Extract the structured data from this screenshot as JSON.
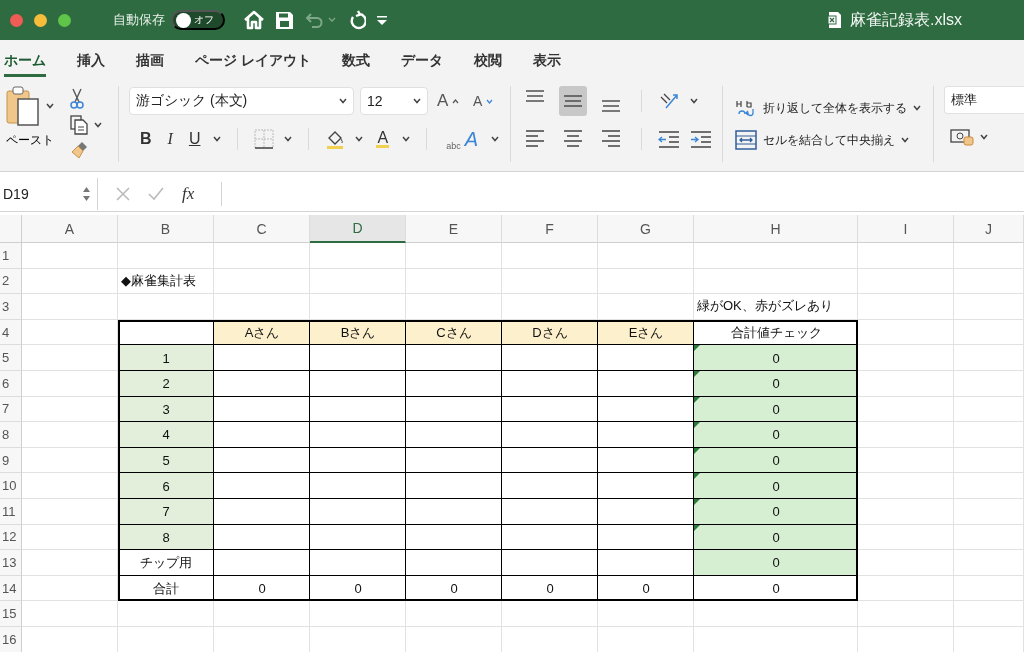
{
  "window": {
    "title": "麻雀記録表.xlsx",
    "autosave": {
      "label": "自動保存",
      "toggle_text": "オフ",
      "on": false
    }
  },
  "tabs": [
    {
      "label": "ホーム",
      "selected": true
    },
    {
      "label": "挿入",
      "selected": false
    },
    {
      "label": "描画",
      "selected": false
    },
    {
      "label": "ページ レイアウト",
      "selected": false
    },
    {
      "label": "数式",
      "selected": false
    },
    {
      "label": "データ",
      "selected": false
    },
    {
      "label": "校閲",
      "selected": false
    },
    {
      "label": "表示",
      "selected": false
    }
  ],
  "ribbon": {
    "paste_label": "ペースト",
    "font_name": "游ゴシック (本文)",
    "font_size": "12",
    "grow_font": "A",
    "shrink_font": "A",
    "bold": "B",
    "italic": "I",
    "underline": "U",
    "font_color": "A",
    "text_effects": {
      "small": "abc",
      "large": "A"
    },
    "vertical_align": [
      {
        "kind": "top",
        "selected": false
      },
      {
        "kind": "middle",
        "selected": true
      },
      {
        "kind": "bottom",
        "selected": false
      }
    ],
    "wrap_text": "折り返して全体を表示する",
    "merge_center": "セルを結合して中央揃え",
    "number_format": "標準"
  },
  "formula_bar": {
    "name_box": "D19",
    "fx": "fx"
  },
  "sheet": {
    "columns": [
      {
        "label": "A",
        "selected": false
      },
      {
        "label": "B",
        "selected": false
      },
      {
        "label": "C",
        "selected": false
      },
      {
        "label": "D",
        "selected": true
      },
      {
        "label": "E",
        "selected": false
      },
      {
        "label": "F",
        "selected": false
      },
      {
        "label": "G",
        "selected": false
      },
      {
        "label": "H",
        "selected": false
      },
      {
        "label": "I",
        "selected": false
      },
      {
        "label": "J",
        "selected": false
      }
    ],
    "rows": [
      {
        "number": "1",
        "cells": [
          {},
          {},
          {},
          {},
          {},
          {},
          {},
          {},
          {},
          {}
        ]
      },
      {
        "number": "2",
        "cells": [
          {},
          {
            "text": "◆麻雀集計表"
          },
          {},
          {},
          {},
          {},
          {},
          {},
          {},
          {}
        ]
      },
      {
        "number": "3",
        "cells": [
          {},
          {},
          {},
          {},
          {},
          {},
          {},
          {
            "text": "緑がOK、赤がズレあり"
          },
          {},
          {}
        ]
      },
      {
        "number": "4",
        "cells": [
          {},
          {
            "kind": "box"
          },
          {
            "kind": "header",
            "text": "Aさん"
          },
          {
            "kind": "header",
            "text": "Bさん"
          },
          {
            "kind": "header",
            "text": "Cさん"
          },
          {
            "kind": "header",
            "text": "Dさん"
          },
          {
            "kind": "header",
            "text": "Eさん"
          },
          {
            "kind": "box",
            "text": "合計値チェック"
          },
          {},
          {}
        ]
      },
      {
        "number": "5",
        "cells": [
          {},
          {
            "kind": "label",
            "text": "1"
          },
          {
            "kind": "box"
          },
          {
            "kind": "box"
          },
          {
            "kind": "box"
          },
          {
            "kind": "box"
          },
          {
            "kind": "box"
          },
          {
            "kind": "check",
            "text": "0",
            "flag": true
          },
          {},
          {}
        ]
      },
      {
        "number": "6",
        "cells": [
          {},
          {
            "kind": "label",
            "text": "2"
          },
          {
            "kind": "box"
          },
          {
            "kind": "box"
          },
          {
            "kind": "box"
          },
          {
            "kind": "box"
          },
          {
            "kind": "box"
          },
          {
            "kind": "check",
            "text": "0",
            "flag": true
          },
          {},
          {}
        ]
      },
      {
        "number": "7",
        "cells": [
          {},
          {
            "kind": "label",
            "text": "3"
          },
          {
            "kind": "box"
          },
          {
            "kind": "box"
          },
          {
            "kind": "box"
          },
          {
            "kind": "box"
          },
          {
            "kind": "box"
          },
          {
            "kind": "check",
            "text": "0",
            "flag": true
          },
          {},
          {}
        ]
      },
      {
        "number": "8",
        "cells": [
          {},
          {
            "kind": "label",
            "text": "4"
          },
          {
            "kind": "box"
          },
          {
            "kind": "box"
          },
          {
            "kind": "box"
          },
          {
            "kind": "box"
          },
          {
            "kind": "box"
          },
          {
            "kind": "check",
            "text": "0",
            "flag": true
          },
          {},
          {}
        ]
      },
      {
        "number": "9",
        "cells": [
          {},
          {
            "kind": "label",
            "text": "5"
          },
          {
            "kind": "box"
          },
          {
            "kind": "box"
          },
          {
            "kind": "box"
          },
          {
            "kind": "box"
          },
          {
            "kind": "box"
          },
          {
            "kind": "check",
            "text": "0",
            "flag": true
          },
          {},
          {}
        ]
      },
      {
        "number": "10",
        "cells": [
          {},
          {
            "kind": "label",
            "text": "6"
          },
          {
            "kind": "box"
          },
          {
            "kind": "box"
          },
          {
            "kind": "box"
          },
          {
            "kind": "box"
          },
          {
            "kind": "box"
          },
          {
            "kind": "check",
            "text": "0",
            "flag": true
          },
          {},
          {}
        ]
      },
      {
        "number": "11",
        "cells": [
          {},
          {
            "kind": "label",
            "text": "7"
          },
          {
            "kind": "box"
          },
          {
            "kind": "box"
          },
          {
            "kind": "box"
          },
          {
            "kind": "box"
          },
          {
            "kind": "box"
          },
          {
            "kind": "check",
            "text": "0",
            "flag": true
          },
          {},
          {}
        ]
      },
      {
        "number": "12",
        "cells": [
          {},
          {
            "kind": "label",
            "text": "8"
          },
          {
            "kind": "box"
          },
          {
            "kind": "box"
          },
          {
            "kind": "box"
          },
          {
            "kind": "box"
          },
          {
            "kind": "box"
          },
          {
            "kind": "check",
            "text": "0",
            "flag": true
          },
          {},
          {}
        ]
      },
      {
        "number": "13",
        "cells": [
          {},
          {
            "kind": "box",
            "text": "チップ用"
          },
          {
            "kind": "box"
          },
          {
            "kind": "box"
          },
          {
            "kind": "box"
          },
          {
            "kind": "box"
          },
          {
            "kind": "box"
          },
          {
            "kind": "check",
            "text": "0",
            "flag": false
          },
          {},
          {}
        ]
      },
      {
        "number": "14",
        "cells": [
          {},
          {
            "kind": "box",
            "text": "合計"
          },
          {
            "kind": "box",
            "text": "0"
          },
          {
            "kind": "box",
            "text": "0"
          },
          {
            "kind": "box",
            "text": "0"
          },
          {
            "kind": "box",
            "text": "0"
          },
          {
            "kind": "box",
            "text": "0"
          },
          {
            "kind": "box",
            "text": "0"
          },
          {},
          {}
        ]
      },
      {
        "number": "15",
        "cells": [
          {},
          {},
          {},
          {},
          {},
          {},
          {},
          {},
          {},
          {}
        ]
      },
      {
        "number": "16",
        "cells": [
          {},
          {},
          {},
          {},
          {},
          {},
          {},
          {},
          {},
          {}
        ]
      }
    ]
  }
}
